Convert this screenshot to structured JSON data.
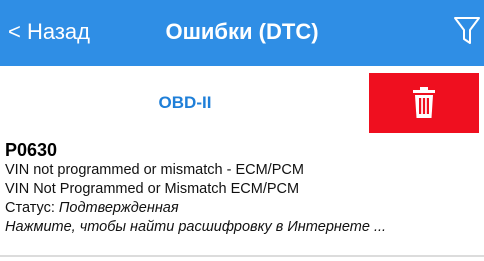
{
  "header": {
    "back_label": "< Назад",
    "title": "Ошибки (DTC)",
    "filter_icon": "filter-icon",
    "bg_color": "#2f8ee5"
  },
  "toolbar": {
    "protocol_label": "OBD-II",
    "delete_icon": "trash-icon",
    "delete_color": "#ef0f1f"
  },
  "dtc": {
    "code": "P0630",
    "description_1": "VIN not programmed or mismatch - ECM/PCM",
    "description_2": "VIN Not Programmed or Mismatch ECM/PCM",
    "status_label": "Статус: ",
    "status_value": "Подтвержденная",
    "search_hint": "Нажмите, чтобы найти расшифровку в Интернете ..."
  }
}
